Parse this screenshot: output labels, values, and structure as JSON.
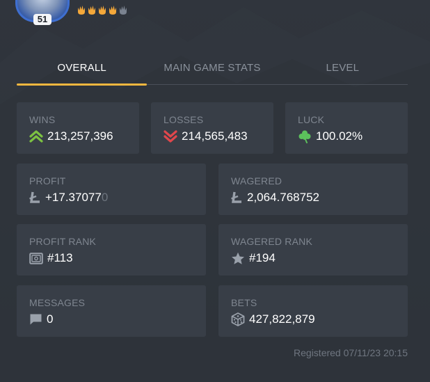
{
  "profile": {
    "level": "51",
    "stars_total": 5,
    "stars_filled": 4
  },
  "tabs": [
    {
      "label": "OVERALL",
      "active": true
    },
    {
      "label": "MAIN GAME STATS",
      "active": false
    },
    {
      "label": "LEVEL",
      "active": false
    }
  ],
  "stats": {
    "wins": {
      "label": "WINS",
      "value": "213,257,396",
      "icon": "double-chevron-up-icon"
    },
    "losses": {
      "label": "LOSSES",
      "value": "214,565,483",
      "icon": "double-chevron-down-icon"
    },
    "luck": {
      "label": "LUCK",
      "value": "100.02%",
      "icon": "clover-icon"
    },
    "profit": {
      "label": "PROFIT",
      "value_main": "+17.37077",
      "value_faded": "0",
      "icon": "litecoin-icon"
    },
    "wagered": {
      "label": "WAGERED",
      "value": "2,064.768752",
      "icon": "litecoin-icon"
    },
    "profit_rank": {
      "label": "PROFIT RANK",
      "value": "#113",
      "icon": "safe-icon"
    },
    "wagered_rank": {
      "label": "WAGERED RANK",
      "value": "#194",
      "icon": "star-icon"
    },
    "messages": {
      "label": "MESSAGES",
      "value": "0",
      "icon": "chat-bubble-icon"
    },
    "bets": {
      "label": "BETS",
      "value": "427,822,879",
      "icon": "dice-icon"
    }
  },
  "registered": "Registered 07/11/23 20:15",
  "colors": {
    "accent": "#f4b73f",
    "wins_green": "#7cc242",
    "losses_red": "#e0474c",
    "clover_green": "#5cc15c"
  }
}
